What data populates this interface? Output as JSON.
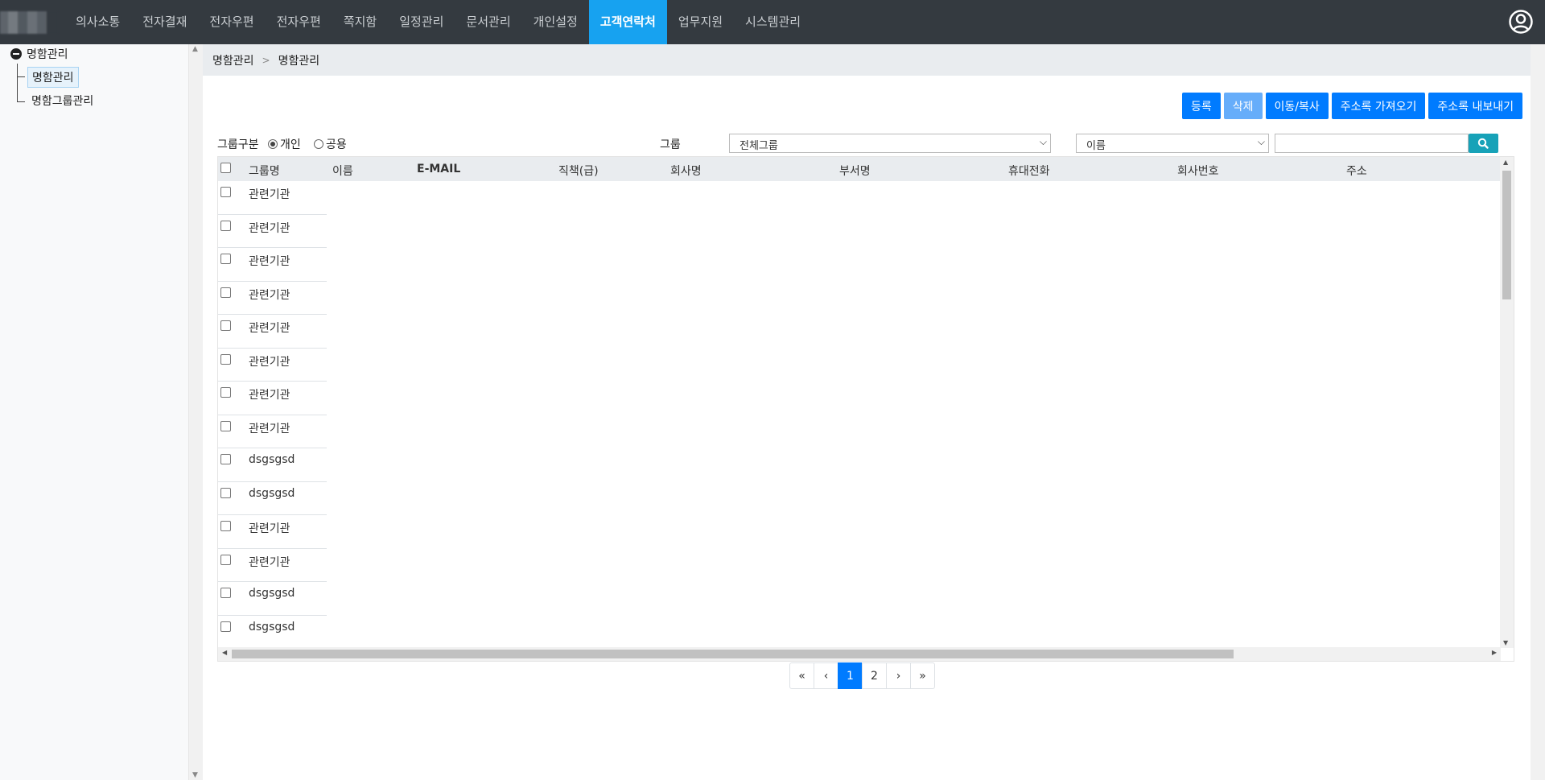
{
  "nav": {
    "items": [
      "의사소통",
      "전자결재",
      "전자우편",
      "전자우편",
      "쪽지함",
      "일정관리",
      "문서관리",
      "개인설정",
      "고객연락처",
      "업무지원",
      "시스템관리"
    ],
    "active_index": 8,
    "user_icon": "user-circle-icon"
  },
  "sidebar": {
    "root": "명함관리",
    "items": [
      "명함관리",
      "명함그룹관리"
    ]
  },
  "breadcrumb": {
    "first": "명함관리",
    "separator": ">",
    "second": "명함관리"
  },
  "buttons": {
    "register": "등록",
    "delete": "삭제",
    "move_copy": "이동/복사",
    "import": "주소록 가져오기",
    "export": "주소록 내보내기"
  },
  "filter": {
    "group_type_label": "그룹구분",
    "radio_personal": "개인",
    "radio_public": "공용",
    "radio_selected": "개인",
    "group_label": "그룹",
    "group_select_value": "전체그룹",
    "field_select_value": "이름",
    "search_value": ""
  },
  "table": {
    "columns": [
      "그룹명",
      "이름",
      "E-MAIL",
      "직책(급)",
      "회사명",
      "부서명",
      "휴대전화",
      "회사번호",
      "주소"
    ],
    "rows": [
      {
        "group": "관련기관"
      },
      {
        "group": "관련기관"
      },
      {
        "group": "관련기관"
      },
      {
        "group": "관련기관"
      },
      {
        "group": "관련기관"
      },
      {
        "group": "관련기관"
      },
      {
        "group": "관련기관"
      },
      {
        "group": "관련기관"
      },
      {
        "group": "dsgsgsd"
      },
      {
        "group": "dsgsgsd"
      },
      {
        "group": "관련기관"
      },
      {
        "group": "관련기관"
      },
      {
        "group": "dsgsgsd"
      },
      {
        "group": "dsgsgsd"
      }
    ]
  },
  "pagination": {
    "first": "«",
    "prev": "‹",
    "pages": [
      "1",
      "2"
    ],
    "current": "1",
    "next": "›",
    "last": "»"
  }
}
